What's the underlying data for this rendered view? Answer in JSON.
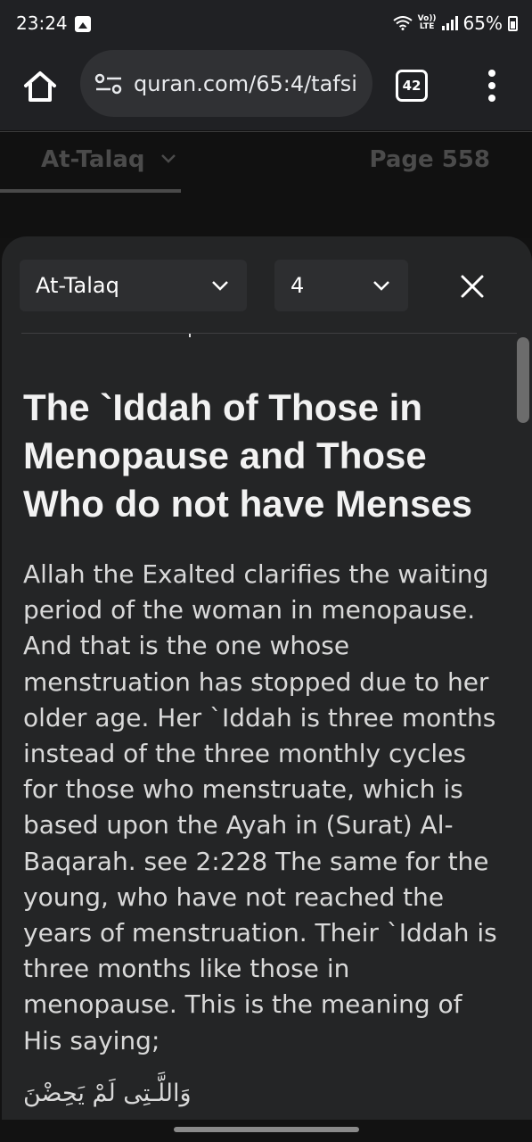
{
  "status_bar": {
    "time": "23:24",
    "battery": "65%",
    "lte_label": "LTE",
    "volte_label": "Vo))",
    "icons": [
      "gallery-icon",
      "wifi-icon",
      "lte-icon",
      "signal-icon",
      "battery-icon"
    ]
  },
  "browser": {
    "url": "quran.com/65:4/tafsi",
    "tab_count": "42",
    "icons": [
      "home-icon",
      "tune-icon",
      "tabs-icon",
      "more-vert-icon"
    ]
  },
  "page_header": {
    "surah": "At-Talaq",
    "page": "Page 558"
  },
  "sheet": {
    "surah_select": "At-Talaq",
    "ayah_select": "4",
    "cut_number": "3",
    "heading": "The `Iddah of Those in Menopause and Those Who do not have Menses",
    "body": "Allah the Exalted clarifies the waiting period of the woman in menopause. And that is the one whose menstruation has stopped due to her older age. Her `Iddah is three months instead of the three monthly cycles for those who menstruate, which is based upon the Ayah in (Surat) Al-Baqarah. see 2:228 The same for the young, who have not reached the years of menstruation. Their `Iddah is three months like those in menopause. This is the meaning of His saying;",
    "arabic": "وَاللَّـتِى لَمْ يَحِضْنَ"
  }
}
